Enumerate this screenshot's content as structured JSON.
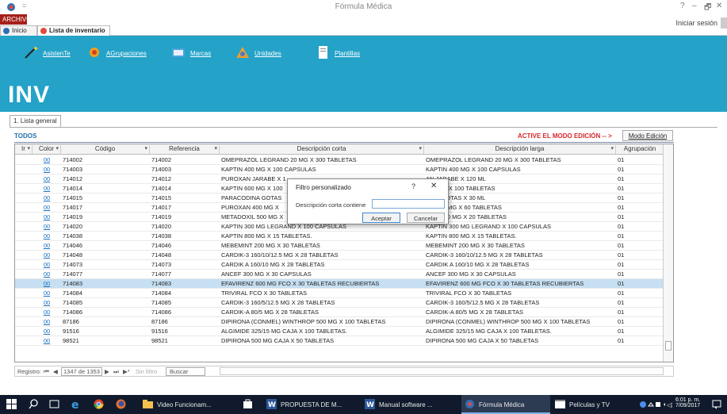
{
  "window": {
    "title": "Fórmula Médica",
    "login": "Iniciar sesión",
    "controls": [
      "?",
      "–",
      "🗗",
      "✕"
    ]
  },
  "ribbon": {
    "archivo": "ARCHIVO",
    "doc_tabs": [
      "Inicio",
      "Lista de inventario"
    ]
  },
  "toolbar": {
    "items": [
      {
        "label": "AsistenTe",
        "icon": "wand-icon"
      },
      {
        "label": "AGrupaciones",
        "icon": "groups-icon"
      },
      {
        "label": "Marcas",
        "icon": "brands-icon"
      },
      {
        "label": "Unidades",
        "icon": "units-icon"
      },
      {
        "label": "Plantillas",
        "icon": "templates-icon"
      }
    ],
    "module": "INV",
    "subtitle": "Lista de inventario"
  },
  "tabs": {
    "active": "1. Lista general"
  },
  "list": {
    "filter_label": "TODOS",
    "edit_notice": "ACTIVE EL MODO EDICIÓN -- >",
    "edit_button": "Modo Edición",
    "columns": [
      "Ir",
      "Color",
      "Código",
      "Referencia",
      "Descripción corta",
      "Descripción larga",
      "Agrupación"
    ],
    "rows": [
      [
        "00",
        "714002",
        "714002",
        "OMEPRAZOL LEGRAND 20 MG X 300 TABLETAS",
        "OMEPRAZOL LEGRAND 20 MG X 300 TABLETAS",
        "01"
      ],
      [
        "00",
        "714003",
        "714003",
        "KAPTIN 400 MG X 100 CAPSULAS",
        "KAPTIN 400 MG X 100 CAPSULAS",
        "01"
      ],
      [
        "00",
        "714012",
        "714012",
        "PUROXAN JARABE X 1",
        "AN JARABE X 120  ML",
        "01"
      ],
      [
        "00",
        "714014",
        "714014",
        "KAPTIN 600 MG X 100",
        "600 MG X 100 TABLETAS",
        "01"
      ],
      [
        "00",
        "714015",
        "714015",
        "PARACODINA GOTAS",
        "DINA GOTAS X 30  ML",
        "01"
      ],
      [
        "00",
        "714017",
        "714017",
        "PUROXAN 400 MG X",
        "AN 400 MG X 60  TABLETAS",
        "01"
      ],
      [
        "00",
        "714019",
        "714019",
        "METADOXIL 500 MG X",
        "DXIL 500 MG X 20  TABLETAS",
        "01"
      ],
      [
        "00",
        "714020",
        "714020",
        "KAPTIN 300 MG LEGRAND  X 100 CAPSULAS",
        "KAPTIN 300 MG LEGRAND  X 100 CAPSULAS",
        "01"
      ],
      [
        "00",
        "714038",
        "714038",
        "KAPTIN 800 MG X 15 TABLETAS.",
        "KAPTIN 800 MG X 15 TABLETAS.",
        "01"
      ],
      [
        "00",
        "714046",
        "714046",
        "MEBEMINT 200 MG X 30  TABLETAS",
        "MEBEMINT 200 MG X 30  TABLETAS",
        "01"
      ],
      [
        "00",
        "714048",
        "714048",
        "CARDIK-3 160/10/12.5 MG X 28 TABLETAS",
        "CARDIK-3 160/10/12.5 MG X 28 TABLETAS",
        "01"
      ],
      [
        "00",
        "714073",
        "714073",
        "CARDIK A 160/10 MG X 28 TABLETAS",
        "CARDIK A 160/10 MG X 28 TABLETAS",
        "01"
      ],
      [
        "00",
        "714077",
        "714077",
        "ANCEF 300 MG X 30 CAPSULAS",
        "ANCEF 300 MG X 30 CAPSULAS",
        "01"
      ],
      [
        "00",
        "714083",
        "714083",
        "EFAVIRENZ 600 MG FCO X 30 TABLETAS RECUBIERTAS",
        "EFAVIRENZ 600 MG FCO X 30 TABLETAS RECUBIERTAS",
        "01"
      ],
      [
        "00",
        "714084",
        "714084",
        "TRIVIRAL FCO X 30 TABLETAS",
        "TRIVIRAL FCO X 30 TABLETAS",
        "01"
      ],
      [
        "00",
        "714085",
        "714085",
        "CARDIK-3 160/5/12.5 MG X 28 TABLETAS",
        "CARDIK-3 160/5/12.5 MG X 28 TABLETAS",
        "01"
      ],
      [
        "00",
        "714086",
        "714086",
        "CARDIK-A 80/5 MG X 28 TABLETAS",
        "CARDIK-A 80/5 MG X 28 TABLETAS",
        "01"
      ],
      [
        "00",
        "87186",
        "87186",
        "DIPIRONA (CONMEL) WINTHROP 500 MG X 100 TABLETAS",
        "DIPIRONA (CONMEL) WINTHROP 500 MG X 100 TABLETAS",
        "01"
      ],
      [
        "00",
        "91516",
        "91516",
        "ALGIMIDE 325/15 MG CAJA X 100 TABLETAS.",
        "ALGIMIDE 325/15 MG CAJA X 100 TABLETAS.",
        "01"
      ],
      [
        "00",
        "98521",
        "98521",
        "DIPIRONA 500 MG CAJA X 50 TABLETAS",
        "DIPIRONA 500 MG CAJA X 50 TABLETAS",
        "01"
      ]
    ],
    "selected_index": 13
  },
  "navigator": {
    "label": "Registro:",
    "first": "⏮",
    "prev": "◀",
    "record_text": "1347 de 1353",
    "next": "▶",
    "last": "⏭",
    "new": "▶*",
    "filter": "Sin filtro",
    "search": "Buscar"
  },
  "dialog": {
    "title": "Filtro personalizado",
    "help": "?",
    "close": "✕",
    "label": "Descripción corta contiene",
    "value": "",
    "ok": "Aceptar",
    "cancel": "Cancelar"
  },
  "taskbar": {
    "items": [
      {
        "label": "",
        "icon": "windows-start-icon"
      },
      {
        "label": "",
        "icon": "search-icon"
      },
      {
        "label": "",
        "icon": "task-view-icon"
      },
      {
        "label": "",
        "icon": "edge-icon"
      },
      {
        "label": "",
        "icon": "chrome-icon"
      },
      {
        "label": "",
        "icon": "firefox-icon"
      },
      {
        "label": "Video Funcionam...",
        "icon": "folder-icon"
      },
      {
        "label": "",
        "icon": "store-icon"
      },
      {
        "label": "PROPUESTA DE M...",
        "icon": "word-icon"
      },
      {
        "label": "Manual software ...",
        "icon": "word-icon"
      },
      {
        "label": "Fórmula Médica",
        "icon": "app-icon"
      },
      {
        "label": "Películas y TV",
        "icon": "movies-icon"
      }
    ],
    "time": "6:01 p. m.",
    "date": "7/09/2017"
  },
  "colors": {
    "band": "#24a2c8",
    "archivo": "#a52019",
    "alert": "#d7262d",
    "taskbar": "#101a2c",
    "selected_row": "#c6dff2"
  }
}
